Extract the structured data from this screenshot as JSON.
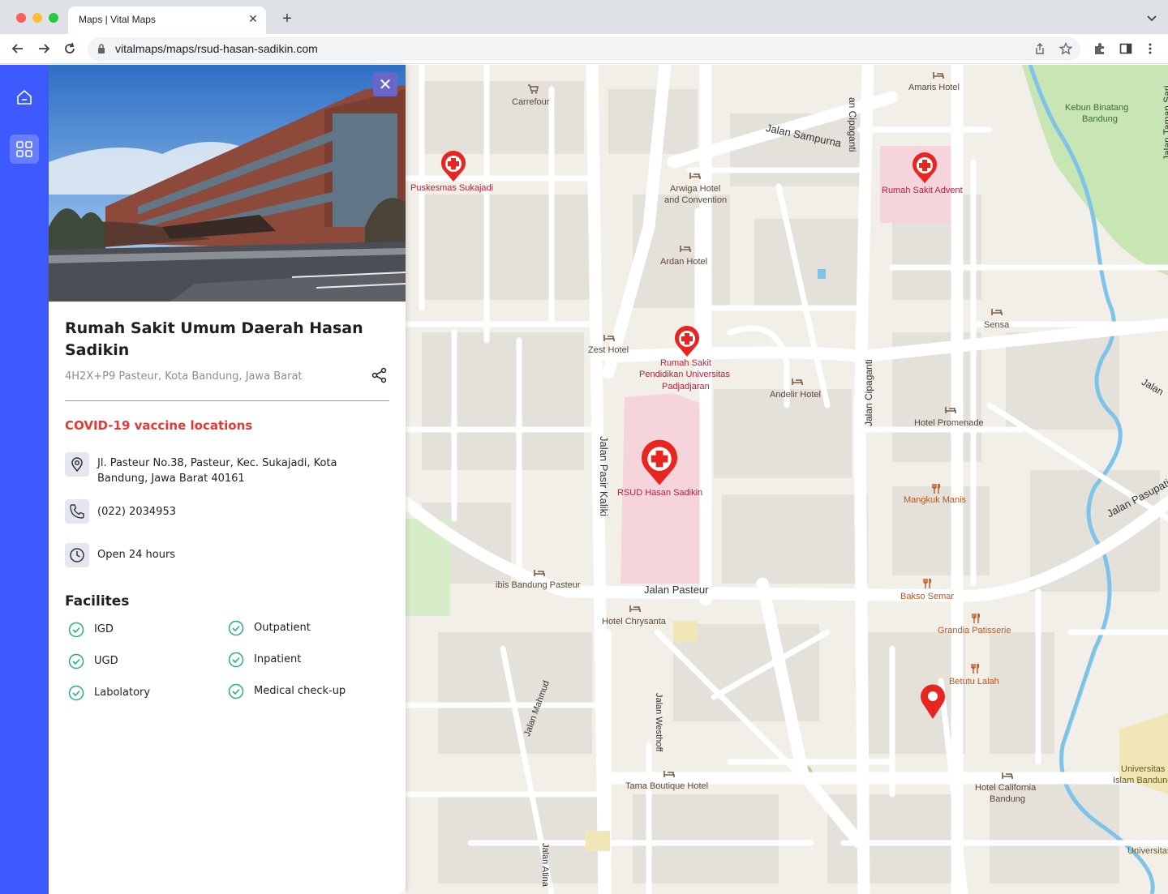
{
  "browser": {
    "tab_title": "Maps | Vital Maps",
    "url": "vitalmaps/maps/rsud-hasan-sadikin.com"
  },
  "place": {
    "name": "Rumah Sakit Umum Daerah Hasan Sadikin",
    "plus_code": "4H2X+P9 Pasteur, Kota Bandung, Jawa Barat",
    "covid_link": "COVID-19 vaccine locations",
    "address": "Jl. Pasteur No.38, Pasteur, Kec. Sukajadi, Kota Bandung, Jawa Barat 40161",
    "phone": "(022) 2034953",
    "hours": "Open 24 hours"
  },
  "facilities": {
    "title": "Facilites",
    "items": [
      "IGD",
      "UGD",
      "Labolatory",
      "Outpatient",
      "Inpatient",
      "Medical check-up"
    ]
  },
  "map": {
    "poi": {
      "carrefour": "Carrefour",
      "amaris": "Amaris Hotel",
      "arwiga_1": "Arwiga Hotel",
      "arwiga_2": "and Convention",
      "ardan": "Ardan Hotel",
      "zest": "Zest Hotel",
      "andelir": "Andelir Hotel",
      "sensa": "Sensa",
      "promenade": "Hotel Promenade",
      "ibis": "ibis Bandung Pasteur",
      "chrysanta": "Hotel Chrysanta",
      "tama": "Tama Boutique Hotel",
      "california_1": "Hotel California",
      "california_2": "Bandung"
    },
    "hospitals": {
      "puskesmas": "Puskesmas Sukajadi",
      "advent": "Rumah Sakit Advent",
      "unpad_1": "Rumah Sakit",
      "unpad_2": "Pendidikan Universitas",
      "unpad_3": "Padjadjaran",
      "rsud": "RSUD Hasan Sadikin"
    },
    "food": {
      "mangkuk": "Mangkuk Manis",
      "bakso": "Bakso Semar",
      "grandia": "Grandia Patisserie",
      "betutu": "Betutu Lalah"
    },
    "streets": {
      "sampurna": "Jalan Sampurna",
      "cipaganti_top": "an Cipaganti",
      "cipaganti": "Jalan Cipaganti",
      "taman_sari": "Jalan Taman Sari",
      "jalan_right": "Jalan",
      "pasir_kaliki": "Jalan Pasir Kaliki",
      "pasteur": "Jalan Pasteur",
      "pasupati": "Jalan Pasupati",
      "mahmud": "Jalan Mahmud",
      "westhoff": "Jalan Westhoff",
      "atina": "Jalan Atina"
    },
    "areas": {
      "kebun_1": "Kebun Binatang",
      "kebun_2": "Bandung",
      "unisba_1": "Universitas",
      "unisba_2": "Islam Bandung",
      "univ_bottom": "Universitas"
    }
  },
  "colors": {
    "rail": "#3d5afe",
    "covid": "#e53935",
    "check": "#26b07e",
    "hospital_pin": "#e8251f"
  }
}
